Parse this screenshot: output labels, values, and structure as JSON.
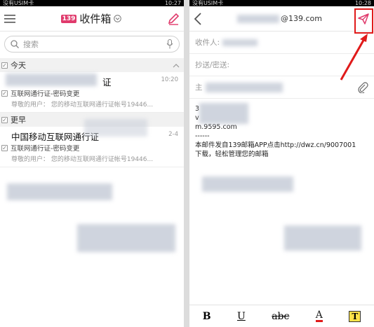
{
  "left": {
    "status": {
      "carrier": "没有USIM卡",
      "time": "10:27"
    },
    "title": "收件箱",
    "logo_text": "139",
    "search_placeholder": "搜索",
    "groups": [
      {
        "label": "今天",
        "mails": [
          {
            "sender": "证",
            "subject": "互联网通行证-密码变更",
            "preview": "尊敬的用户： 您的移动互联网通行证帐号19446...",
            "time": "10:20"
          }
        ]
      },
      {
        "label": "更早",
        "mails": [
          {
            "sender": "中国移动互联网通行证",
            "subject": "互联网通行证-密码变更",
            "preview": "尊敬的用户： 您的移动互联网通行证帐号19446...",
            "time": "2-4"
          }
        ]
      }
    ]
  },
  "right": {
    "status": {
      "carrier": "没有USIM卡",
      "time": "10:28"
    },
    "account": "@139.com",
    "to_label": "收件人:",
    "cc_label": "抄送/密送:",
    "subject_label": "主",
    "body_lines": [
      "3",
      "v",
      "m.9595.com",
      "------",
      "本邮件发自139邮箱APP点击http://dwz.cn/9007001",
      "下载，轻松管理您的邮箱"
    ],
    "format": {
      "bold": "B",
      "underline": "U",
      "strike": "abc",
      "color": "A",
      "highlight": "T"
    }
  },
  "colors": {
    "accent": "#e03a6c",
    "annotation": "#e01a1a",
    "highlight": "#ffe24a"
  }
}
